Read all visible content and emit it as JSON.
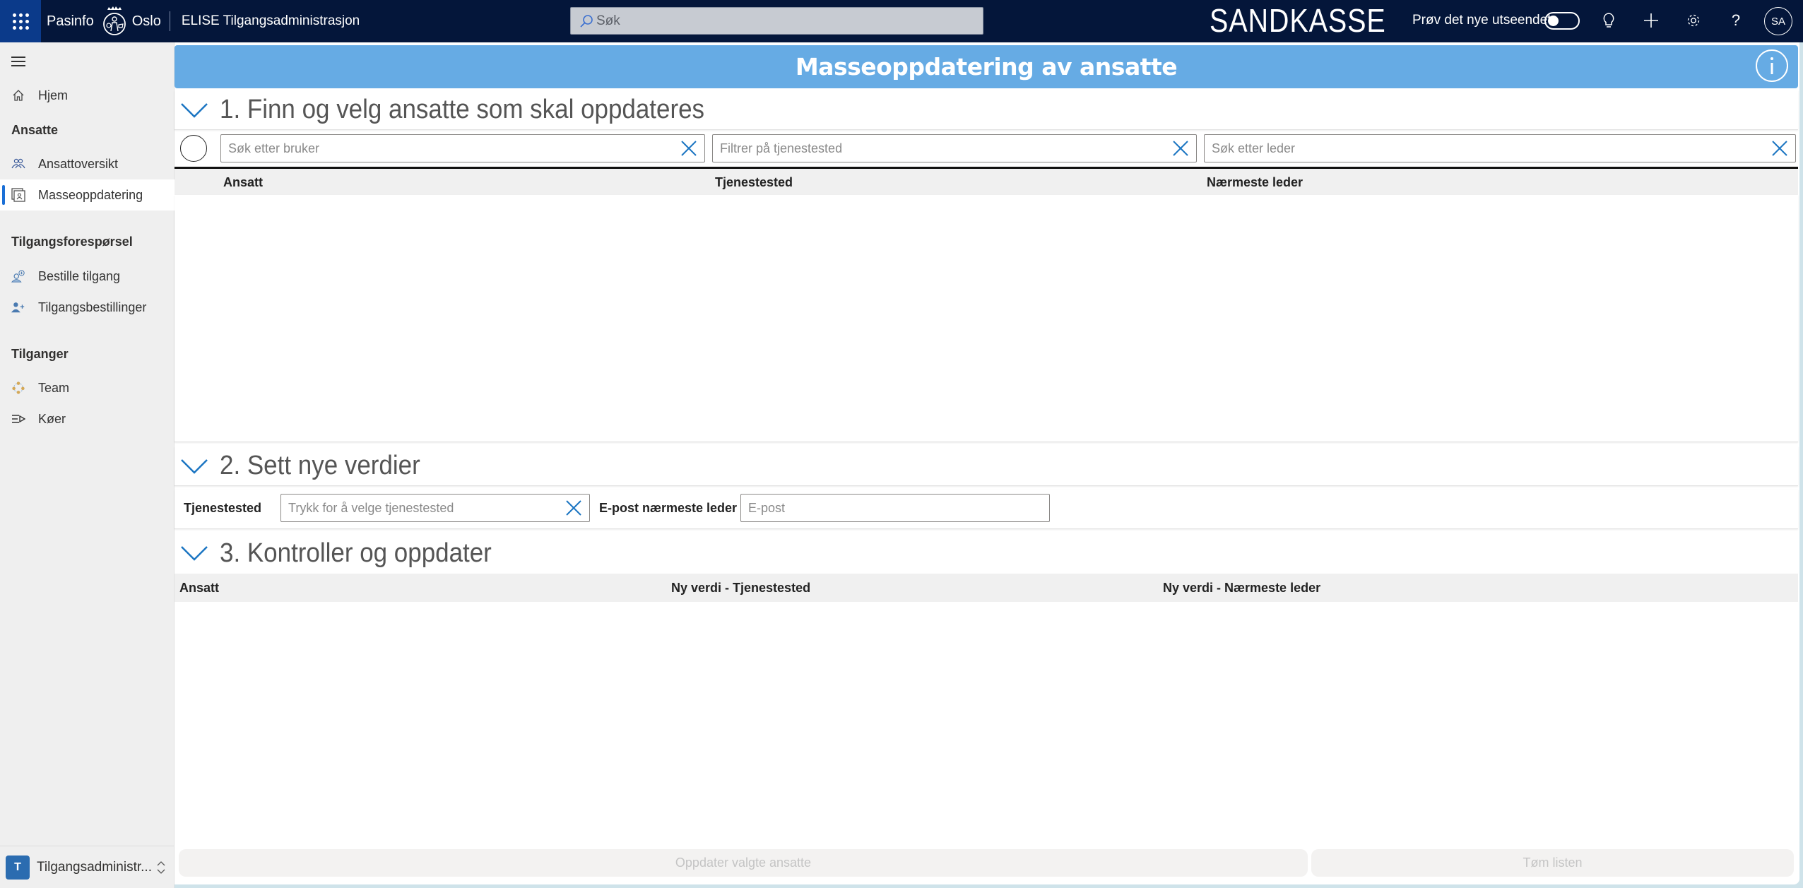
{
  "header": {
    "org_name": "Pasinfo",
    "city": "Oslo",
    "app_title": "ELISE Tilgangsadministrasjon",
    "search_placeholder": "Søk",
    "environment_label": "SANDKASSE",
    "try_new_label": "Prøv det nye utseendet",
    "try_new_enabled": false,
    "avatar_initials": "SA",
    "icons": [
      "waffle-icon",
      "lightbulb-icon",
      "plus-icon",
      "gear-icon",
      "help-icon"
    ]
  },
  "sidebar": {
    "items": [
      {
        "label": "Hjem",
        "icon": "home-icon"
      },
      {
        "group": "Ansatte"
      },
      {
        "label": "Ansattoversikt",
        "icon": "people-icon"
      },
      {
        "label": "Masseoppdatering",
        "icon": "contact-card-icon",
        "active": true
      },
      {
        "group": "Tilgangsforespørsel"
      },
      {
        "label": "Bestille tilgang",
        "icon": "user-add-request-icon"
      },
      {
        "label": "Tilgangsbestillinger",
        "icon": "user-plus-icon"
      },
      {
        "group": "Tilganger"
      },
      {
        "label": "Team",
        "icon": "team-icon"
      },
      {
        "label": "Køer",
        "icon": "queue-icon"
      }
    ],
    "app_switcher": {
      "badge": "T",
      "label": "Tilgangsadministr..."
    }
  },
  "main": {
    "banner_title": "Masseoppdatering av ansatte",
    "section1": {
      "title": "1. Finn og velg ansatte som skal oppdateres",
      "filters": {
        "user_placeholder": "Søk etter bruker",
        "workplace_placeholder": "Filtrer på tjenestested",
        "manager_placeholder": "Søk etter leder"
      },
      "columns": [
        "Ansatt",
        "Tjenestested",
        "Nærmeste leder"
      ],
      "rows": []
    },
    "section2": {
      "title": "2. Sett nye verdier",
      "workplace_label": "Tjenestested",
      "workplace_placeholder": "Trykk for å velge tjenestested",
      "manager_email_label": "E-post nærmeste leder",
      "manager_email_placeholder": "E-post"
    },
    "section3": {
      "title": "3. Kontroller og oppdater",
      "columns": [
        "Ansatt",
        "Ny verdi - Tjenestested",
        "Ny verdi - Nærmeste leder"
      ],
      "rows": []
    },
    "buttons": {
      "update": "Oppdater valgte ansatte",
      "clear": "Tøm listen"
    }
  },
  "colors": {
    "header_bg": "#04163a",
    "banner_bg": "#66abe4",
    "accent": "#1a6fd6",
    "chevron": "#1b75c2"
  }
}
